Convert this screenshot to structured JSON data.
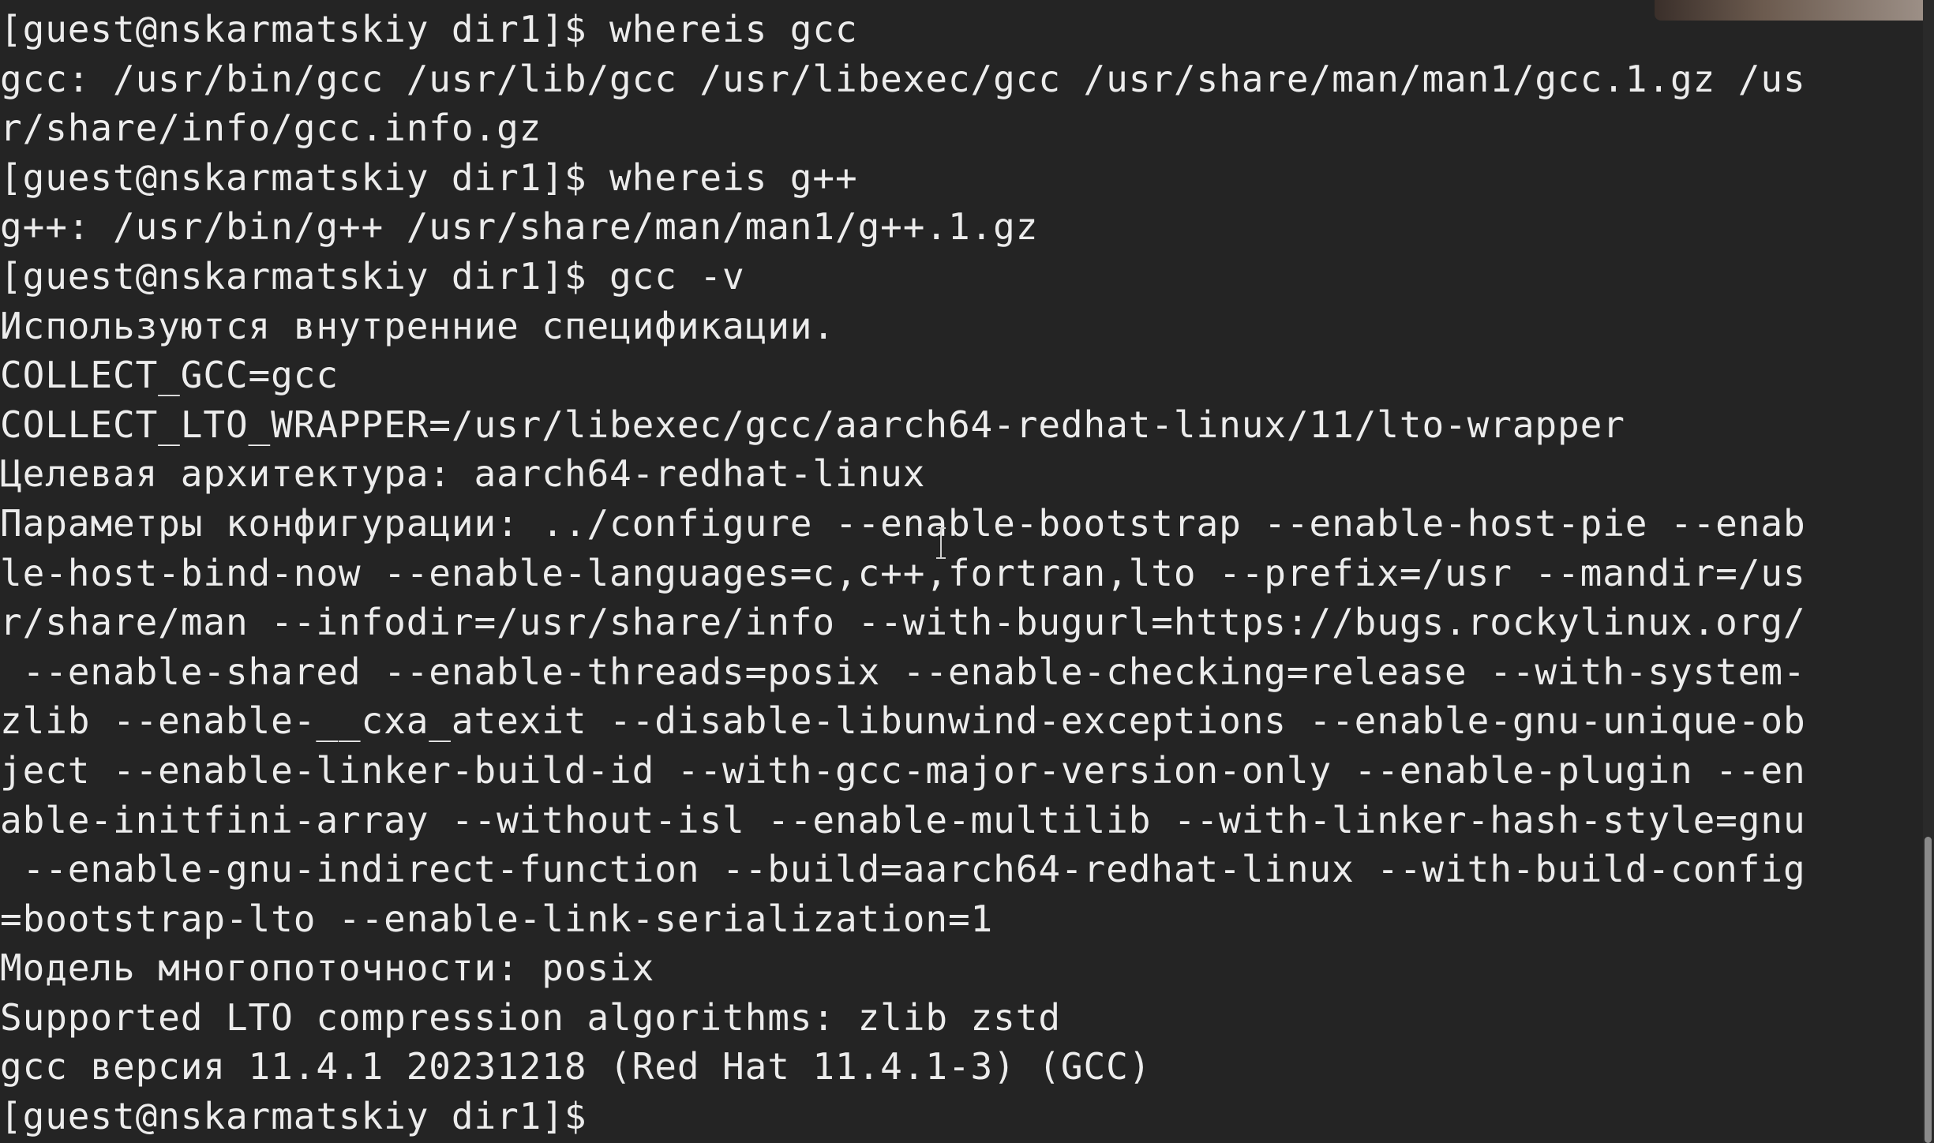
{
  "terminal": {
    "lines": [
      "[guest@nskarmatskiy dir1]$ whereis gcc",
      "gcc: /usr/bin/gcc /usr/lib/gcc /usr/libexec/gcc /usr/share/man/man1/gcc.1.gz /us",
      "r/share/info/gcc.info.gz",
      "[guest@nskarmatskiy dir1]$ whereis g++",
      "g++: /usr/bin/g++ /usr/share/man/man1/g++.1.gz",
      "[guest@nskarmatskiy dir1]$ gcc -v",
      "Используются внутренние спецификации.",
      "COLLECT_GCC=gcc",
      "COLLECT_LTO_WRAPPER=/usr/libexec/gcc/aarch64-redhat-linux/11/lto-wrapper",
      "Целевая архитектура: aarch64-redhat-linux",
      "Параметры конфигурации: ../configure --enable-bootstrap --enable-host-pie --enab",
      "le-host-bind-now --enable-languages=c,c++,fortran,lto --prefix=/usr --mandir=/us",
      "r/share/man --infodir=/usr/share/info --with-bugurl=https://bugs.rockylinux.org/",
      " --enable-shared --enable-threads=posix --enable-checking=release --with-system-",
      "zlib --enable-__cxa_atexit --disable-libunwind-exceptions --enable-gnu-unique-ob",
      "ject --enable-linker-build-id --with-gcc-major-version-only --enable-plugin --en",
      "able-initfini-array --without-isl --enable-multilib --with-linker-hash-style=gnu",
      " --enable-gnu-indirect-function --build=aarch64-redhat-linux --with-build-config",
      "=bootstrap-lto --enable-link-serialization=1",
      "Модель многопоточности: posix",
      "Supported LTO compression algorithms: zlib zstd",
      "gcc версия 11.4.1 20231218 (Red Hat 11.4.1-3) (GCC)",
      "[guest@nskarmatskiy dir1]$ "
    ]
  },
  "colors": {
    "background": "#242424",
    "foreground": "#ececec"
  },
  "icons": {
    "mouse_cursor": "ibeam-cursor-icon"
  }
}
